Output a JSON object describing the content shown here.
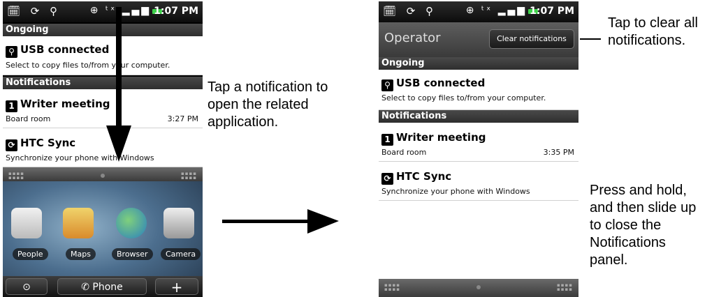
{
  "status": {
    "time": "1:07 PM",
    "left_icons": "🗓 ⟳ ⚲",
    "right_icons": "⊕ ᵗˣ ▂▄▆"
  },
  "sections": {
    "ongoing": "Ongoing",
    "notifications": "Notifications"
  },
  "usb": {
    "title": "USB connected",
    "subtitle": "Select to copy files to/from your computer."
  },
  "writer": {
    "title": "Writer meeting",
    "subtitle": "Board room",
    "time1": "3:27 PM",
    "time2": "3:35 PM"
  },
  "htcsync": {
    "title": "HTC Sync",
    "subtitle": "Synchronize your phone with Windows"
  },
  "apps": {
    "people": "People",
    "maps": "Maps",
    "browser": "Browser",
    "camera": "Camera"
  },
  "dock": {
    "phone": "Phone",
    "plus": "+"
  },
  "operator": {
    "name": "Operator",
    "clear_button": "Clear notifications"
  },
  "callouts": {
    "tap_notification": [
      "Tap a notification to",
      "open the related",
      "application."
    ],
    "tap_clear": [
      "Tap to clear all",
      "notifications."
    ],
    "press_hold": [
      "Press and hold,",
      "and then slide up",
      "to close the",
      "Notifications",
      "panel."
    ]
  },
  "icons": {
    "usb": "usb-icon",
    "calendar": "calendar-icon",
    "sync": "sync-icon"
  },
  "colors": {
    "battery": "#3fd24b",
    "section_header": "#3a3a3a"
  }
}
